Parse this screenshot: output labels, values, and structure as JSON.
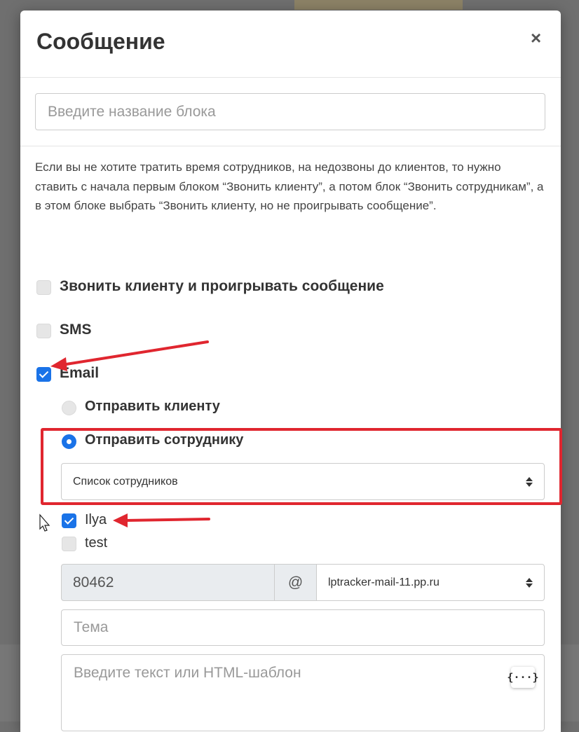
{
  "modal": {
    "title": "Сообщение",
    "close_symbol": "×"
  },
  "block_name": {
    "placeholder": "Введите название блока"
  },
  "description": "Если вы не хотите тратить время сотрудников, на недозвоны до клиентов, то нужно ставить с начала первым блоком “Звонить клиенту”, а потом блок “Звонить сотрудникам”, а в этом блоке выбрать “Звонить клиенту, но не проигрывать сообщение”.",
  "options": {
    "call_client": {
      "label": "Звонить клиенту и проигрывать сообщение",
      "checked": false
    },
    "sms": {
      "label": "SMS",
      "checked": false
    },
    "email": {
      "label": "Email",
      "checked": true
    }
  },
  "email_targets": {
    "client": {
      "label": "Отправить клиенту",
      "selected": false
    },
    "employee": {
      "label": "Отправить сотруднику",
      "selected": true
    }
  },
  "employee_list": {
    "selected": "Список сотрудников"
  },
  "employees": [
    {
      "name": "Ilya",
      "checked": true
    },
    {
      "name": "test",
      "checked": false
    }
  ],
  "sender": {
    "local_part": "80462",
    "at_symbol": "@",
    "domain": "lptracker-mail-11.pp.ru"
  },
  "subject": {
    "placeholder": "Тема"
  },
  "body": {
    "placeholder": "Введите текст или HTML-шаблон",
    "variables_button": "{···}"
  },
  "colors": {
    "accent": "#1a73e8",
    "annotation_red": "#e0262f"
  },
  "icons": [
    "close-icon",
    "checkbox-icon",
    "radio-icon",
    "select-caret-icon",
    "mouse-cursor-icon",
    "annotation-arrow"
  ]
}
